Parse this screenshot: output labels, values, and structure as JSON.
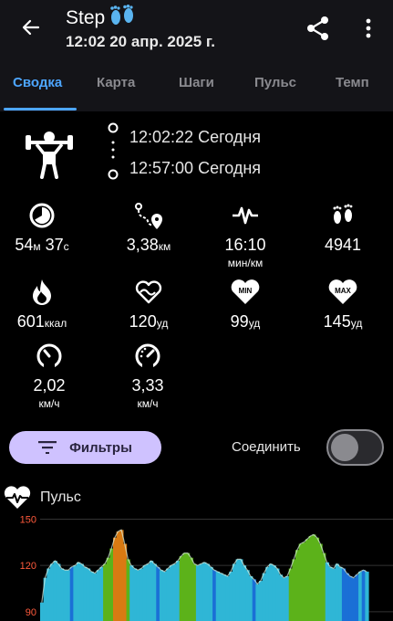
{
  "header": {
    "title": "Step",
    "subtitle": "12:02 20 апр. 2025 г."
  },
  "tabs": [
    {
      "label": "Сводка",
      "active": true
    },
    {
      "label": "Карта",
      "active": false
    },
    {
      "label": "Шаги",
      "active": false
    },
    {
      "label": "Пульс",
      "active": false
    },
    {
      "label": "Темп",
      "active": false
    }
  ],
  "session": {
    "start": "12:02:22 Сегодня",
    "end": "12:57:00 Сегодня"
  },
  "stats": {
    "duration": {
      "h": "54",
      "h_unit": "м",
      "m": " 37",
      "m_unit": "с"
    },
    "distance": {
      "value": "3,38",
      "unit": "км"
    },
    "pace": {
      "value": "16:10",
      "unit": "мин/км"
    },
    "steps": {
      "value": "4941"
    },
    "calories": {
      "value": "601",
      "unit": "ккал"
    },
    "avg_hr": {
      "value": "120",
      "unit": "уд"
    },
    "min_hr": {
      "value": "99",
      "unit": "уд",
      "badge": "MIN"
    },
    "max_hr": {
      "value": "145",
      "unit": "уд",
      "badge": "MAX"
    },
    "avg_speed": {
      "value": "2,02",
      "unit": "км/ч"
    },
    "max_speed": {
      "value": "3,33",
      "unit": "км/ч"
    }
  },
  "controls": {
    "filter_label": "Фильтры",
    "join_label": "Соединить",
    "join_enabled": false
  },
  "chart_data": {
    "type": "area",
    "title": "Пульс",
    "ylabel": "",
    "y_ticks": [
      "150",
      "120",
      "90"
    ],
    "ylim": [
      84,
      155
    ],
    "colors": {
      "zone_light": "#2fb6d6",
      "zone_blue": "#1a6fd6",
      "zone_green": "#5cb21a",
      "zone_orange": "#d97a12",
      "tick": "#ff5a3c"
    },
    "series": [
      {
        "values": [
          96,
          112,
          118,
          121,
          123,
          121,
          118,
          117,
          117,
          119,
          120,
          122,
          121,
          119,
          118,
          116,
          115,
          117,
          119,
          121,
          125,
          131,
          138,
          142,
          143,
          134,
          124,
          120,
          118,
          117,
          118,
          120,
          121,
          123,
          121,
          119,
          117,
          116,
          118,
          120,
          121,
          123,
          126,
          128,
          128,
          125,
          121,
          120,
          121,
          122,
          121,
          119,
          117,
          116,
          115,
          114,
          113,
          116,
          121,
          124,
          124,
          120,
          117,
          113,
          111,
          108,
          110,
          115,
          119,
          121,
          120,
          118,
          114,
          112,
          113,
          118,
          124,
          130,
          134,
          135,
          137,
          139,
          140,
          138,
          134,
          128,
          122,
          119,
          118,
          121,
          119,
          118,
          115,
          113,
          112,
          114,
          116,
          117,
          116
        ]
      }
    ],
    "zones": [
      "light",
      "light",
      "light",
      "light",
      "light",
      "light",
      "light",
      "light",
      "light",
      "blue",
      "light",
      "light",
      "light",
      "light",
      "light",
      "light",
      "light",
      "light",
      "light",
      "green",
      "green",
      "green",
      "orange",
      "orange",
      "orange",
      "orange",
      "green",
      "light",
      "light",
      "light",
      "light",
      "light",
      "light",
      "light",
      "light",
      "blue",
      "light",
      "light",
      "light",
      "light",
      "light",
      "light",
      "green",
      "green",
      "green",
      "green",
      "green",
      "light",
      "light",
      "light",
      "light",
      "light",
      "blue",
      "light",
      "light",
      "light",
      "light",
      "light",
      "light",
      "light",
      "light",
      "light",
      "light",
      "light",
      "blue",
      "light",
      "light",
      "light",
      "light",
      "light",
      "light",
      "light",
      "light",
      "light",
      "light",
      "green",
      "green",
      "green",
      "green",
      "green",
      "green",
      "green",
      "green",
      "green",
      "green",
      "green",
      "light",
      "light",
      "light",
      "light",
      "light",
      "blue",
      "blue",
      "blue",
      "blue",
      "blue",
      "light",
      "blue",
      "light"
    ]
  }
}
